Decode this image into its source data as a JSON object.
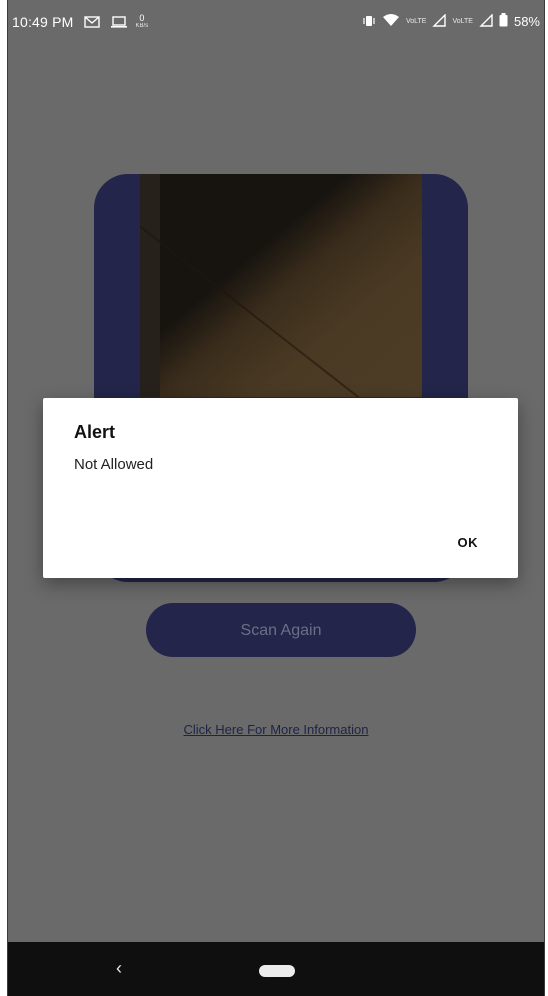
{
  "status_bar": {
    "time": "10:49 PM",
    "net_speed": "0",
    "net_speed_unit": "KB/s",
    "volte_1": "VoLTE",
    "volte_2": "VoLTE",
    "battery_percent": "58%",
    "icons": [
      "gmail-icon",
      "laptop-icon",
      "vibrate-icon",
      "wifi-icon",
      "signal-icon",
      "battery-icon"
    ]
  },
  "scanner": {
    "scan_again_label": "Scan Again",
    "info_link_label": "Click Here For More Information"
  },
  "alert": {
    "title": "Alert",
    "message": "Not Allowed",
    "ok_label": "OK"
  },
  "navbar": {
    "back_glyph": "‹"
  },
  "colors": {
    "accent": "#23254a",
    "background_dimmed": "#6a6a6a",
    "link": "#1d2448"
  }
}
